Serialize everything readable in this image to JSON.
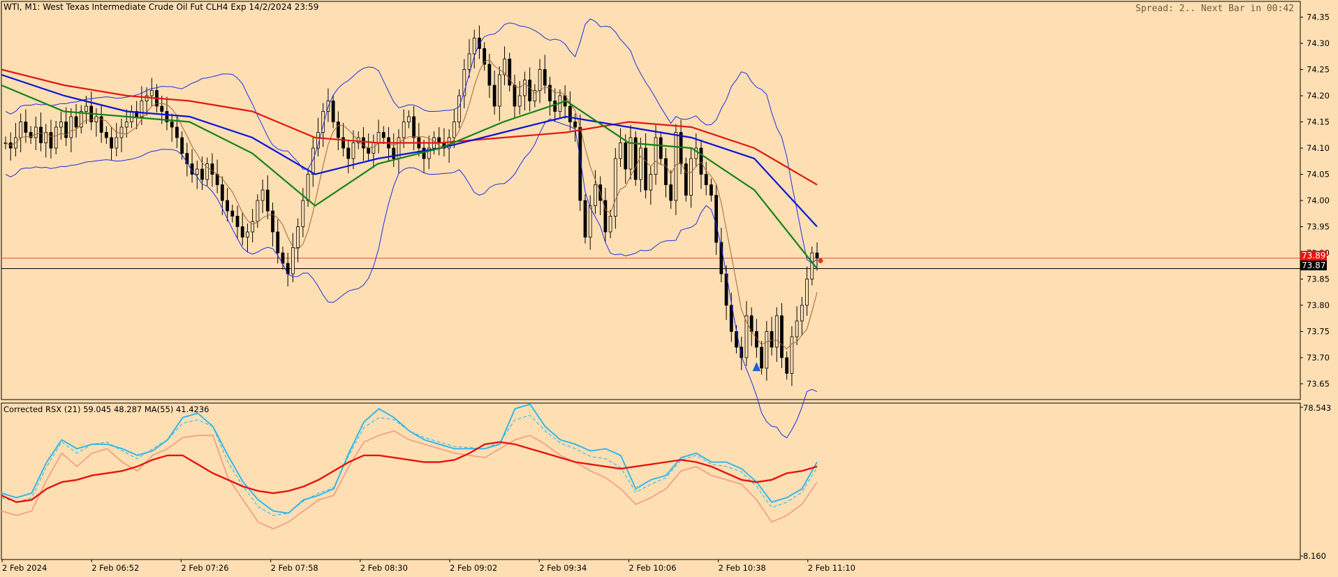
{
  "window": {
    "title": "WTI, M1:  West Texas Intermediate Crude Oil Fut CLH4 Exp 14/2/2024 23:59",
    "status_right": "Spread: 2.. Next Bar in 00:42"
  },
  "colors": {
    "background": "#FDDFB3",
    "candle": "#000000",
    "ma_red": "#E2180F",
    "ma_blue": "#0A14D8",
    "ma_green": "#148214",
    "bollinger": "#1E2CE6",
    "thin_ma": "#A0643A",
    "bid_line": "#000000",
    "ask_line": "#E05050",
    "rsx_main": "#22B4F0",
    "rsx_ma": "#E6140F",
    "rsx_low": "#F4A085"
  },
  "price_panel": {
    "price_labels": [
      "74.35",
      "74.30",
      "74.25",
      "74.20",
      "74.15",
      "74.10",
      "74.05",
      "74.00",
      "73.95",
      "73.90",
      "73.85",
      "73.80",
      "73.75",
      "73.70",
      "73.65"
    ],
    "ask_price": "73.89",
    "bid_price": "73.87"
  },
  "indicator_panel": {
    "label": "Corrected RSX (21) 59.045 48.287 MA(55) 41.4236",
    "scale_top": "78.543",
    "scale_bottom": "8.160"
  },
  "time_axis": {
    "labels": [
      "2 Feb 2024",
      "2 Feb 06:52",
      "2 Feb 07:26",
      "2 Feb 07:58",
      "2 Feb 08:30",
      "2 Feb 09:02",
      "2 Feb 09:34",
      "2 Feb 10:06",
      "2 Feb 10:38",
      "2 Feb 11:10"
    ]
  },
  "chart_data": {
    "type": "candlestick",
    "symbol": "WTI",
    "timeframe": "M1",
    "y_range": [
      73.62,
      74.38
    ],
    "close": [
      74.11,
      74.1,
      74.12,
      74.15,
      74.13,
      74.12,
      74.14,
      74.11,
      74.13,
      74.1,
      74.14,
      74.15,
      74.12,
      74.16,
      74.14,
      74.17,
      74.18,
      74.15,
      74.16,
      74.13,
      74.12,
      74.1,
      74.12,
      74.14,
      74.15,
      74.17,
      74.16,
      74.19,
      74.2,
      74.21,
      74.18,
      74.17,
      74.15,
      74.14,
      74.12,
      74.09,
      74.07,
      74.05,
      74.06,
      74.04,
      74.07,
      74.05,
      74.03,
      74.0,
      73.98,
      73.97,
      73.95,
      73.93,
      73.94,
      73.96,
      74.0,
      74.02,
      73.98,
      73.94,
      73.9,
      73.88,
      73.86,
      73.91,
      73.95,
      74.0,
      74.05,
      74.1,
      74.13,
      74.17,
      74.19,
      74.15,
      74.12,
      74.1,
      74.08,
      74.11,
      74.12,
      74.1,
      74.09,
      74.11,
      74.13,
      74.12,
      74.1,
      74.08,
      74.12,
      74.15,
      74.16,
      74.12,
      74.1,
      74.08,
      74.1,
      74.12,
      74.11,
      74.1,
      74.12,
      74.15,
      74.2,
      74.25,
      74.28,
      74.31,
      74.29,
      74.26,
      74.22,
      74.18,
      74.24,
      74.27,
      74.22,
      74.18,
      74.2,
      74.23,
      74.19,
      74.21,
      74.25,
      74.22,
      74.19,
      74.17,
      74.2,
      74.18,
      74.15,
      74.14,
      74.0,
      73.93,
      73.99,
      74.03,
      74.0,
      73.94,
      73.97,
      74.08,
      74.11,
      74.06,
      74.12,
      74.04,
      74.1,
      74.02,
      74.05,
      74.12,
      74.08,
      74.03,
      74.0,
      74.13,
      74.07,
      74.01,
      74.08,
      74.1,
      74.05,
      74.03,
      74.01,
      73.92,
      73.86,
      73.8,
      73.75,
      73.72,
      73.7,
      73.78,
      73.75,
      73.72,
      73.68,
      73.75,
      73.72,
      73.78,
      73.7,
      73.67,
      73.74,
      73.77,
      73.8,
      73.85,
      73.9,
      73.89
    ],
    "series": [
      {
        "name": "MA red",
        "values": [
          74.25,
          74.22,
          74.2,
          74.19,
          74.17,
          74.12,
          74.11,
          74.11,
          74.12,
          74.13,
          74.15,
          74.14,
          74.1,
          74.03
        ]
      },
      {
        "name": "MA blue",
        "values": [
          74.24,
          74.2,
          74.17,
          74.16,
          74.12,
          74.05,
          74.08,
          74.1,
          74.13,
          74.16,
          74.14,
          74.12,
          74.08,
          73.95
        ]
      },
      {
        "name": "MA green",
        "values": [
          74.22,
          74.17,
          74.16,
          74.15,
          74.09,
          73.99,
          74.07,
          74.1,
          74.15,
          74.19,
          74.11,
          74.1,
          74.02,
          73.87
        ]
      }
    ],
    "rsx": {
      "y_range": [
        8.16,
        78.543
      ],
      "main": [
        38,
        36,
        38,
        52,
        62,
        58,
        60,
        60,
        58,
        55,
        57,
        62,
        72,
        74,
        68,
        55,
        43,
        35,
        30,
        29,
        35,
        37,
        40,
        56,
        70,
        76,
        72,
        66,
        62,
        60,
        58,
        58,
        58,
        60,
        76,
        78,
        68,
        62,
        60,
        57,
        58,
        55,
        40,
        44,
        46,
        54,
        56,
        52,
        52,
        49,
        43,
        34,
        36,
        40,
        52
      ],
      "ma": [
        37,
        34,
        35,
        40,
        43,
        44,
        46,
        47,
        48,
        50,
        53,
        55,
        55,
        51,
        47,
        44,
        41,
        39,
        38,
        39,
        41,
        44,
        48,
        52,
        55,
        55,
        54,
        53,
        52,
        52,
        53,
        56,
        60,
        61,
        60,
        58,
        56,
        54,
        52,
        51,
        50,
        49,
        50,
        51,
        52,
        53,
        52,
        50,
        47,
        44,
        43,
        44,
        47,
        48,
        50
      ],
      "low": [
        30,
        28,
        30,
        44,
        56,
        50,
        56,
        58,
        52,
        48,
        55,
        58,
        63,
        64,
        64,
        45,
        35,
        25,
        22,
        25,
        30,
        35,
        37,
        50,
        61,
        64,
        66,
        62,
        60,
        58,
        56,
        55,
        54,
        58,
        62,
        64,
        60,
        55,
        52,
        48,
        45,
        40,
        33,
        36,
        40,
        48,
        50,
        46,
        44,
        42,
        35,
        25,
        28,
        33,
        43
      ]
    }
  }
}
